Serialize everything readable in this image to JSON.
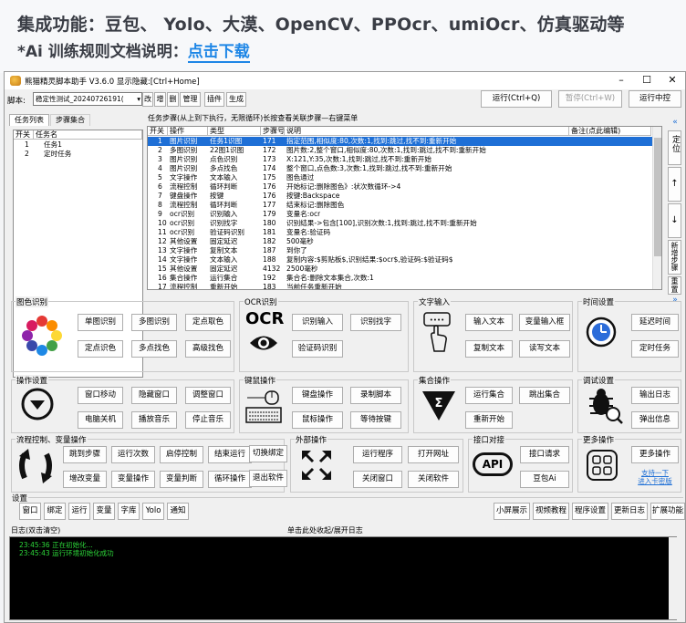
{
  "promo": {
    "line1": "集成功能：豆包、 Yolo、大漠、OpenCV、PPOcr、umiOcr、仿真驱动等",
    "line2_prefix": "*Ai 训练规则文档说明：",
    "line2_link": "点击下载"
  },
  "window": {
    "title": "熊猫精灵脚本助手 V3.6.0 显示隐藏:[Ctrl+Home]",
    "minimize": "–",
    "maximize": "☐",
    "close": "✕"
  },
  "toolbar": {
    "script_label": "脚本:",
    "script_value": "稳定性测试_20240726191(",
    "buttons": [
      "改",
      "增",
      "删",
      "管理",
      "插件",
      "生成"
    ],
    "run": "运行(Ctrl+Q)",
    "pause": "暂停(Ctrl+W)",
    "run_control": "运行中控"
  },
  "tabs": [
    "任务列表",
    "步骤集合"
  ],
  "task_list": {
    "headers": [
      "开关",
      "任务名"
    ],
    "rows": [
      {
        "id": "1",
        "name": "任务1"
      },
      {
        "id": "2",
        "name": "定时任务"
      }
    ]
  },
  "steps_hint": "任务步骤(从上到下执行，无限循环)长按查看关联步骤—右键菜单",
  "steps": {
    "headers": [
      "开关",
      "操作",
      "类型",
      "步骤号",
      "说明",
      "备注(点此编辑)"
    ],
    "rows": [
      {
        "n": "1",
        "op": "图片识别",
        "type": "任务1识图",
        "id": "171",
        "desc": "指定范围,相似度:80,次数:1,找到:跳过,找不到:重新开始"
      },
      {
        "n": "2",
        "op": "多图识别",
        "type": "22图1识图",
        "id": "172",
        "desc": "图片数:2,整个窗口,相似度:80,次数:1,找到:跳过,找不到:重新开始"
      },
      {
        "n": "3",
        "op": "图片识别",
        "type": "点色识别",
        "id": "173",
        "desc": "X:121,Y:35,次数:1,找到:跳过,找不到:重新开始"
      },
      {
        "n": "4",
        "op": "图片识别",
        "type": "多点找色",
        "id": "174",
        "desc": "整个窗口,点色数:3,次数:1,找到:跳过,找不到:重新开始"
      },
      {
        "n": "5",
        "op": "文字操作",
        "type": "文本输入",
        "id": "175",
        "desc": "图色通过"
      },
      {
        "n": "6",
        "op": "流程控制",
        "type": "循环判断",
        "id": "176",
        "desc": "开始标记:删除图色》:状次数循环->4"
      },
      {
        "n": "7",
        "op": "键盘操作",
        "type": "按键",
        "id": "176",
        "desc": "按键:Backspace"
      },
      {
        "n": "8",
        "op": "流程控制",
        "type": "循环判断",
        "id": "177",
        "desc": "结束标记:删除图色"
      },
      {
        "n": "9",
        "op": "ocr识别",
        "type": "识别输入",
        "id": "179",
        "desc": "变量名:ocr"
      },
      {
        "n": "10",
        "op": "ocr识别",
        "type": "识别找字",
        "id": "180",
        "desc": "识别结果->包含[100],识别次数:1,找到:跳过,找不到:重新开始"
      },
      {
        "n": "11",
        "op": "ocr识别",
        "type": "验证码识别",
        "id": "181",
        "desc": "变量名:验证码"
      },
      {
        "n": "12",
        "op": "其他设置",
        "type": "固定延迟",
        "id": "182",
        "desc": "500毫秒"
      },
      {
        "n": "13",
        "op": "文字操作",
        "type": "复制文本",
        "id": "187",
        "desc": "到你了"
      },
      {
        "n": "14",
        "op": "文字操作",
        "type": "文本输入",
        "id": "188",
        "desc": "复制内容:$剪贴板$,识别结果:$ocr$,验证码:$验证码$"
      },
      {
        "n": "15",
        "op": "其他设置",
        "type": "固定延迟",
        "id": "4132",
        "desc": "2500毫秒"
      },
      {
        "n": "16",
        "op": "集合操作",
        "type": "运行集合",
        "id": "192",
        "desc": "集合名:删除文本集合,次数:1"
      },
      {
        "n": "17",
        "op": "流程控制",
        "type": "重新开始",
        "id": "183",
        "desc": "当前任务重新开始"
      }
    ]
  },
  "side_buttons": [
    "«",
    "定位",
    "↑",
    "↓",
    "新增步骤",
    "重置",
    "»"
  ],
  "panels": {
    "image": {
      "title": "图色识别",
      "buttons": [
        "单图识别",
        "多图识别",
        "定点取色",
        "定点识色",
        "多点找色",
        "高级找色"
      ]
    },
    "ocr": {
      "title": "OCR识别",
      "buttons": [
        "识别输入",
        "识别找字",
        "验证码识别"
      ],
      "logo": "OCR"
    },
    "text": {
      "title": "文字输入",
      "buttons": [
        "输入文本",
        "变量输入框",
        "复制文本",
        "读写文本"
      ]
    },
    "time": {
      "title": "时间设置",
      "buttons": [
        "延迟时间",
        "定时任务"
      ]
    },
    "window_ops": {
      "title": "操作设置",
      "buttons": [
        "窗口移动",
        "隐藏窗口",
        "调整窗口",
        "电脑关机",
        "播放音乐",
        "停止音乐"
      ]
    },
    "keyboard": {
      "title": "键鼠操作",
      "buttons": [
        "键盘操作",
        "录制脚本",
        "鼠标操作",
        "等待按键"
      ]
    },
    "collection": {
      "title": "集合操作",
      "buttons": [
        "运行集合",
        "跳出集合",
        "重新开始"
      ]
    },
    "debug": {
      "title": "调试设置",
      "buttons": [
        "输出日志",
        "弹出信息"
      ]
    },
    "flow": {
      "title": "流程控制、变量操作",
      "buttons": [
        "跳到步骤",
        "运行次数",
        "启停控制",
        "结束运行",
        "切换绑定",
        "增改变量",
        "变量操作",
        "变量判断",
        "循环操作",
        "退出软件"
      ]
    },
    "external": {
      "title": "外部操作",
      "buttons": [
        "运行程序",
        "打开网址",
        "关闭窗口",
        "关闭软件"
      ]
    },
    "api": {
      "title": "接口对接",
      "buttons": [
        "接口请求",
        "豆包Ai"
      ],
      "logo": "API"
    },
    "more": {
      "title": "更多操作",
      "buttons": [
        "更多操作"
      ],
      "link": "支持一下\n进入卡密版"
    }
  },
  "settings": {
    "title": "设置",
    "left": [
      "窗口",
      "绑定",
      "运行",
      "变量",
      "字库",
      "Yolo",
      "通知"
    ],
    "right": [
      "小屏展示",
      "视频教程",
      "程序设置",
      "更新日志",
      "扩展功能"
    ]
  },
  "logpanel": {
    "title": "日志(双击清空)",
    "toggle": "单击此处收起/展开日志",
    "lines": [
      "23:45:36  正在初始化...",
      "23:45:43  运行环境初始化成功"
    ]
  },
  "colors": {
    "selected": "#1e6fd6",
    "link": "#1e86e6",
    "log_text": "#2dd83a"
  }
}
